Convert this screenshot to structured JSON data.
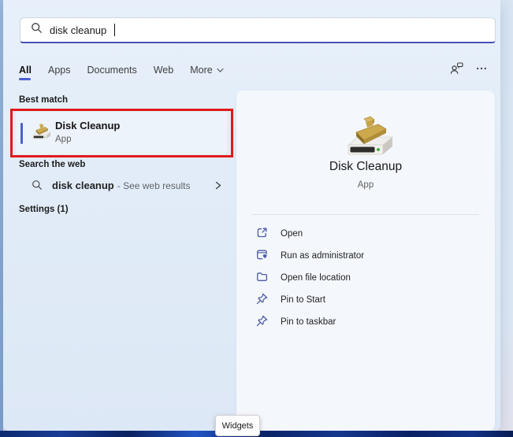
{
  "search": {
    "value": "disk cleanup"
  },
  "tabs": {
    "items": [
      {
        "label": "All"
      },
      {
        "label": "Apps"
      },
      {
        "label": "Documents"
      },
      {
        "label": "Web"
      },
      {
        "label": "More"
      }
    ]
  },
  "left_pane": {
    "best_match_heading": "Best match",
    "best_match": {
      "title": "Disk Cleanup",
      "subtitle": "App"
    },
    "search_web_heading": "Search the web",
    "web_result": {
      "query": "disk cleanup",
      "suffix": "- See web results"
    },
    "settings_heading": "Settings (1)"
  },
  "preview": {
    "title": "Disk Cleanup",
    "subtitle": "App",
    "actions": [
      {
        "label": "Open",
        "icon": "open-external-icon"
      },
      {
        "label": "Run as administrator",
        "icon": "admin-window-icon"
      },
      {
        "label": "Open file location",
        "icon": "folder-icon"
      },
      {
        "label": "Pin to Start",
        "icon": "pin-icon"
      },
      {
        "label": "Pin to taskbar",
        "icon": "pin-icon"
      }
    ]
  },
  "tooltip": {
    "label": "Widgets"
  },
  "colors": {
    "accent": "#4a5fd0",
    "annotation_red": "#e11a1a",
    "flyout_bg": "#e2ecf8",
    "panel_bg": "#f4f7fc",
    "action_icon": "#4d5da6",
    "taskbar_blue": "#0d2a6e"
  }
}
